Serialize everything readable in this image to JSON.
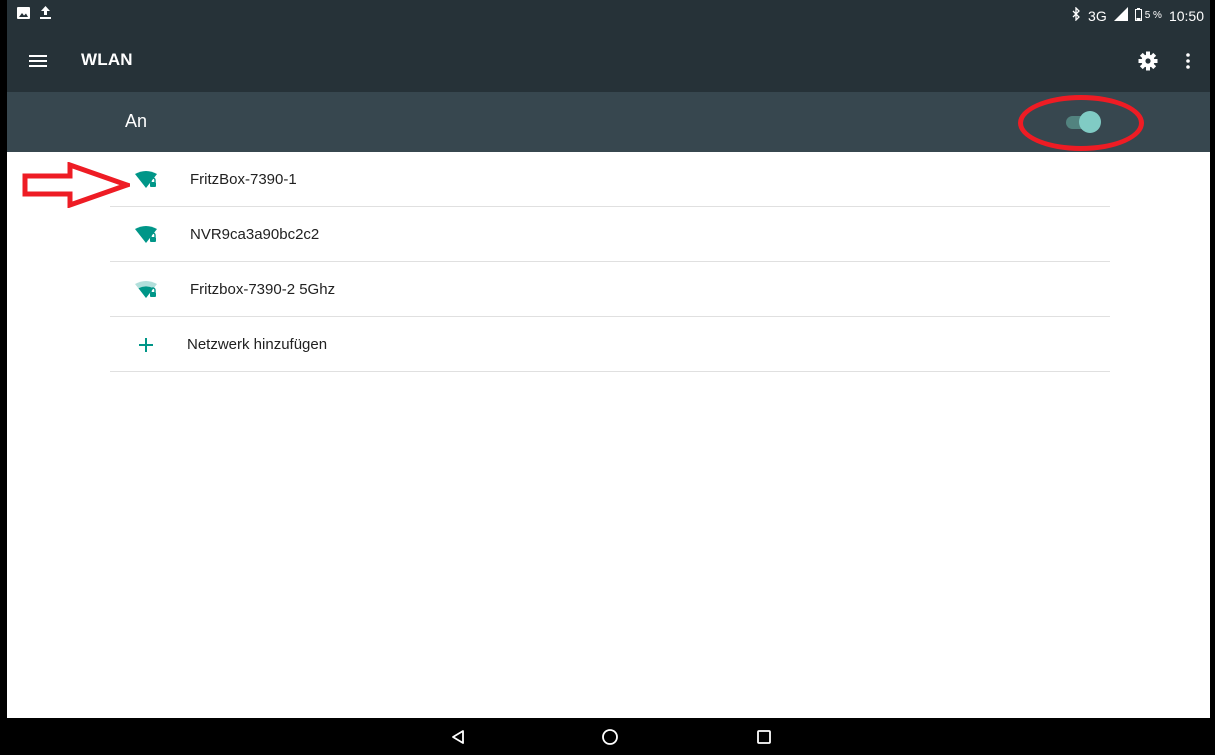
{
  "status_bar": {
    "left_icons": [
      "image-icon",
      "upload-icon"
    ],
    "right_icons": [
      "bluetooth-icon",
      "signal-icon",
      "battery-icon"
    ],
    "network": "3G",
    "battery_percent": "5 %",
    "time": "10:50"
  },
  "toolbar": {
    "title": "WLAN",
    "icons": [
      "menu-icon",
      "gear-icon",
      "more-vert-icon"
    ]
  },
  "switch_bar": {
    "label": "An",
    "toggle_on": true
  },
  "networks": [
    {
      "ssid": "FritzBox-7390-1",
      "icon": "wifi-secured-icon",
      "signal": 3
    },
    {
      "ssid": "NVR9ca3a90bc2c2",
      "icon": "wifi-secured-icon",
      "signal": 3
    },
    {
      "ssid": "Fritzbox-7390-2 5Ghz",
      "icon": "wifi-secured-icon",
      "signal": 2
    }
  ],
  "add_network": {
    "label": "Netzwerk hinzufügen",
    "icon": "plus-icon"
  },
  "nav_bar": {
    "icons": [
      "back-icon",
      "home-icon",
      "recents-icon"
    ]
  },
  "annotations": {
    "color": "#ee1c24",
    "shapes": [
      "arrow",
      "ellipse"
    ]
  },
  "colors": {
    "toolbar": "#263238",
    "switch_bar": "#37474f",
    "accent": "#009688",
    "toggle_thumb": "#80cbc4"
  }
}
